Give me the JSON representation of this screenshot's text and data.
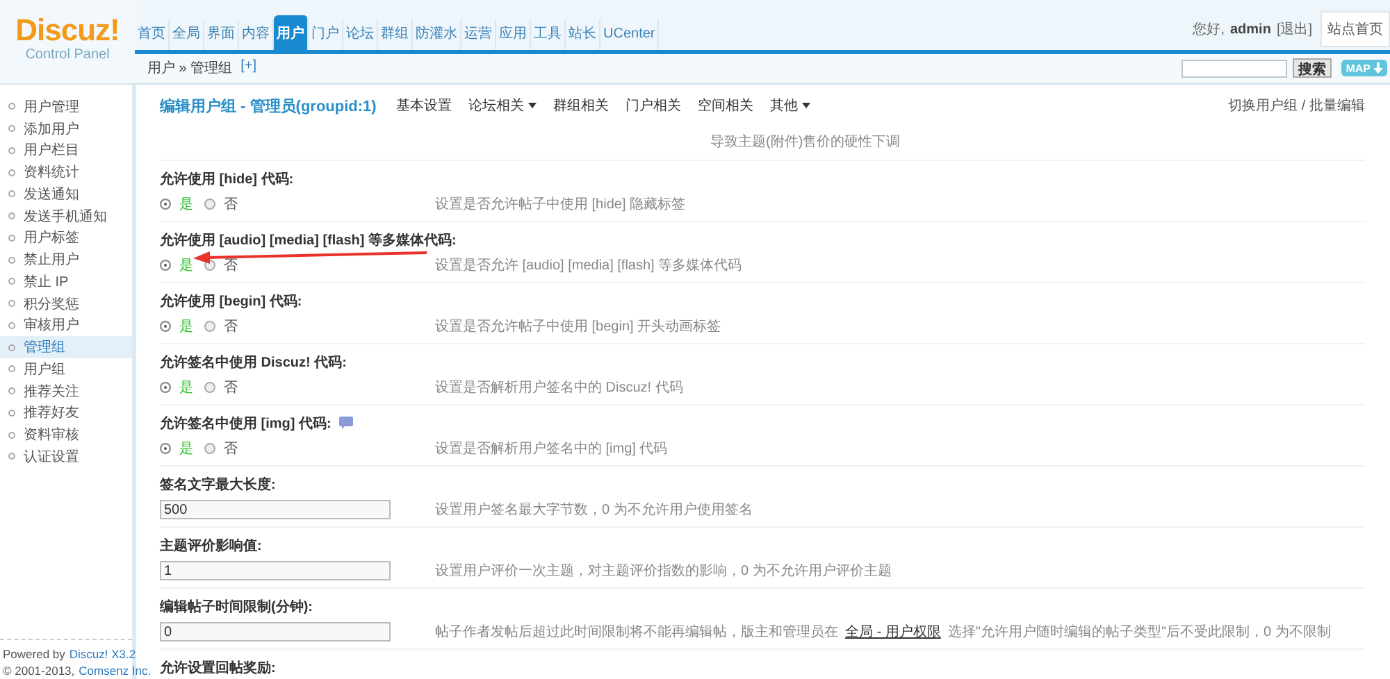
{
  "logo": {
    "brand": "Discuz!",
    "subtitle": "Control Panel"
  },
  "nav": [
    {
      "label": "首页",
      "selected": false
    },
    {
      "label": "全局",
      "selected": false
    },
    {
      "label": "界面",
      "selected": false
    },
    {
      "label": "内容",
      "selected": false
    },
    {
      "label": "用户",
      "selected": true
    },
    {
      "label": "门户",
      "selected": false
    },
    {
      "label": "论坛",
      "selected": false
    },
    {
      "label": "群组",
      "selected": false
    },
    {
      "label": "防灌水",
      "selected": false
    },
    {
      "label": "运营",
      "selected": false
    },
    {
      "label": "应用",
      "selected": false
    },
    {
      "label": "工具",
      "selected": false
    },
    {
      "label": "站长",
      "selected": false
    },
    {
      "label": "UCenter",
      "selected": false
    }
  ],
  "user_bar": {
    "greeting": "您好,",
    "user": "admin",
    "logout": "[退出]",
    "home_button": "站点首页"
  },
  "breadcrumb": {
    "path": "用户 » 管理组",
    "add": "[+]"
  },
  "search": {
    "button": "搜索",
    "map_button": "MAP"
  },
  "sidebar": {
    "items": [
      {
        "label": "用户管理",
        "selected": false
      },
      {
        "label": "添加用户",
        "selected": false
      },
      {
        "label": "用户栏目",
        "selected": false
      },
      {
        "label": "资料统计",
        "selected": false
      },
      {
        "label": "发送通知",
        "selected": false
      },
      {
        "label": "发送手机通知",
        "selected": false
      },
      {
        "label": "用户标签",
        "selected": false
      },
      {
        "label": "禁止用户",
        "selected": false
      },
      {
        "label": "禁止 IP",
        "selected": false
      },
      {
        "label": "积分奖惩",
        "selected": false
      },
      {
        "label": "审核用户",
        "selected": false
      },
      {
        "label": "管理组",
        "selected": true
      },
      {
        "label": "用户组",
        "selected": false
      },
      {
        "label": "推荐关注",
        "selected": false
      },
      {
        "label": "推荐好友",
        "selected": false
      },
      {
        "label": "资料审核",
        "selected": false
      },
      {
        "label": "认证设置",
        "selected": false
      }
    ],
    "footer": {
      "powered": "Powered by",
      "product": "Discuz! X3.2",
      "copyright": "© 2001-2013,",
      "company": "Comsenz Inc."
    }
  },
  "page": {
    "title": "编辑用户组 - 管理员(groupid:1)",
    "tabs": [
      {
        "label": "基本设置",
        "has_menu": false
      },
      {
        "label": "论坛相关",
        "has_menu": true
      },
      {
        "label": "群组相关",
        "has_menu": false
      },
      {
        "label": "门户相关",
        "has_menu": false
      },
      {
        "label": "空间相关",
        "has_menu": false
      },
      {
        "label": "其他",
        "has_menu": true
      }
    ],
    "switch_link": "切换用户组 / 批量编辑"
  },
  "rows": [
    {
      "kind": "note",
      "description": "导致主题(附件)售价的硬性下调"
    },
    {
      "kind": "radio",
      "label": "允许使用 [hide] 代码:",
      "yes": "是",
      "no": "否",
      "value": true,
      "description": "设置是否允许帖子中使用 [hide] 隐藏标签"
    },
    {
      "kind": "radio",
      "label": "允许使用 [audio] [media] [flash] 等多媒体代码:",
      "yes": "是",
      "no": "否",
      "value": true,
      "description": "设置是否允许 [audio] [media] [flash] 等多媒体代码"
    },
    {
      "kind": "radio",
      "label": "允许使用 [begin] 代码:",
      "yes": "是",
      "no": "否",
      "value": true,
      "description": "设置是否允许帖子中使用 [begin] 开头动画标签"
    },
    {
      "kind": "radio",
      "label": "允许签名中使用 Discuz! 代码:",
      "yes": "是",
      "no": "否",
      "value": true,
      "description": "设置是否解析用户签名中的 Discuz! 代码"
    },
    {
      "kind": "radio",
      "label": "允许签名中使用 [img] 代码:",
      "help": true,
      "yes": "是",
      "no": "否",
      "value": true,
      "description": "设置是否解析用户签名中的 [img] 代码"
    },
    {
      "kind": "text",
      "label": "签名文字最大长度:",
      "value": "500",
      "description": "设置用户签名最大字节数，0 为不允许用户使用签名"
    },
    {
      "kind": "text",
      "label": "主题评价影响值:",
      "value": "1",
      "description": "设置用户评价一次主题，对主题评价指数的影响，0 为不允许用户评价主题"
    },
    {
      "kind": "text",
      "label": "编辑帖子时间限制(分钟):",
      "value": "0",
      "description": "帖子作者发帖后超过此时间限制将不能再编辑帖，版主和管理员在",
      "link": "全局 - 用户权限",
      "description_after": "选择\"允许用户随时编辑的帖子类型\"后不受此限制，0 为不限制"
    },
    {
      "kind": "label",
      "label": "允许设置回帖奖励:"
    }
  ]
}
